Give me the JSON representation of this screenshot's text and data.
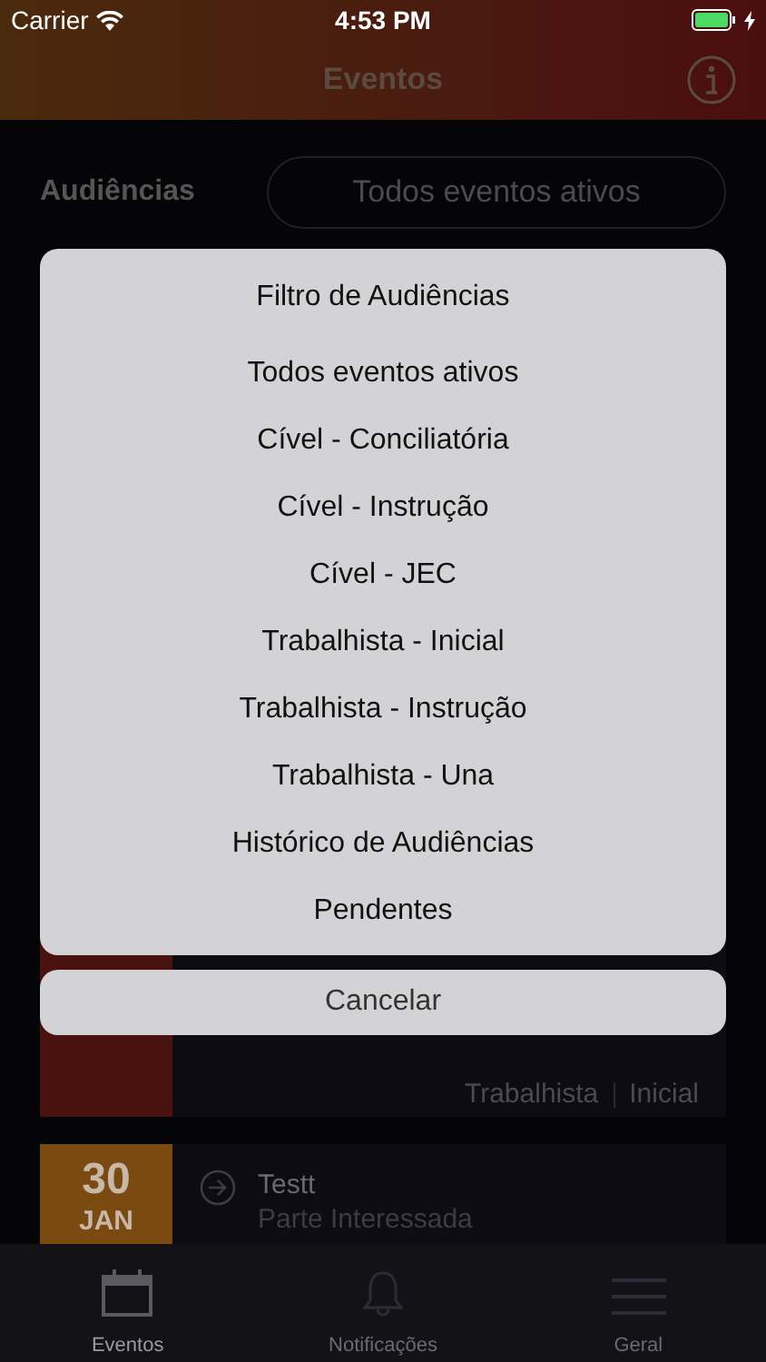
{
  "status_bar": {
    "carrier": "Carrier",
    "time": "4:53 PM",
    "charging": true
  },
  "nav_bar": {
    "title": "Eventos"
  },
  "filter": {
    "label": "Audiências",
    "value": "Todos eventos ativos"
  },
  "events": [
    {
      "color": "#4a120e",
      "tags": [
        "Trabalhista",
        "Inicial"
      ]
    },
    {
      "color": "#7a4a10",
      "day": "30",
      "month": "JAN",
      "entries": [
        {
          "title": "Testt",
          "subtitle": "Parte Interessada"
        }
      ]
    }
  ],
  "action_sheet": {
    "title": "Filtro de Audiências",
    "options": [
      "Todos eventos ativos",
      "Cível - Conciliatória",
      "Cível - Instrução",
      "Cível - JEC",
      "Trabalhista - Inicial",
      "Trabalhista - Instrução",
      "Trabalhista - Una",
      "Histórico de Audiências",
      "Pendentes"
    ],
    "cancel": "Cancelar"
  },
  "tab_bar": [
    {
      "kind": "calendar",
      "label": "Eventos",
      "selected": true
    },
    {
      "kind": "bell",
      "label": "Notificações",
      "selected": false
    },
    {
      "kind": "menu",
      "label": "Geral",
      "selected": false
    }
  ]
}
